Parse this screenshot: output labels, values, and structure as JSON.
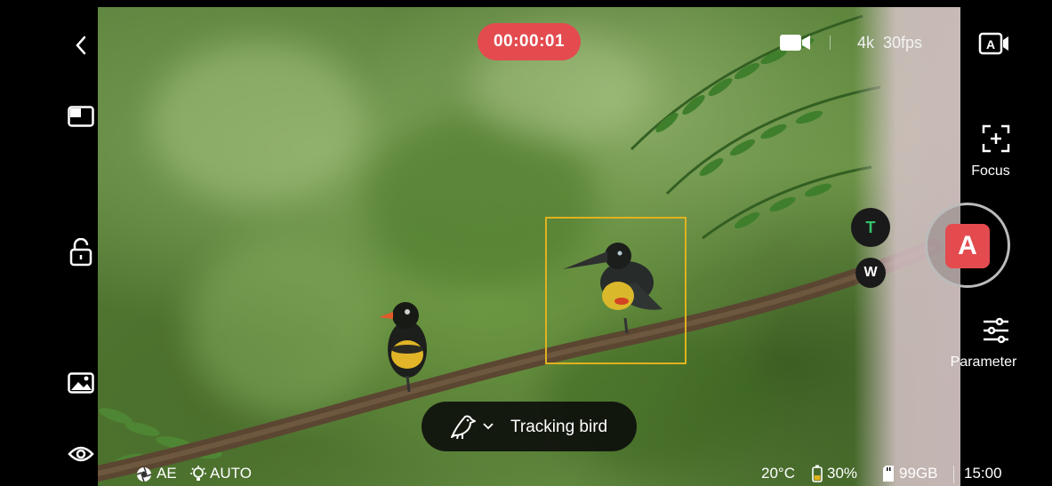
{
  "recording": {
    "timer": "00:00:01"
  },
  "top_bar": {
    "resolution": "4k  30fps"
  },
  "right_panel": {
    "focus_label": "Focus",
    "parameter_label": "Parameter",
    "zoom_tele": "T",
    "zoom_wide": "W",
    "shutter_mode": "A"
  },
  "tracking": {
    "label": "Tracking bird"
  },
  "status_left": {
    "ae_label": "AE",
    "wb_label": "AUTO"
  },
  "status_right": {
    "temperature": "20°C",
    "battery": "30%",
    "storage": "99GB",
    "remaining_time": "15:00"
  },
  "icons": {
    "back": "chevron-left-icon",
    "layout": "layout-icon",
    "lock": "unlock-icon",
    "gallery": "gallery-icon",
    "eye": "eye-icon",
    "camera": "video-camera-icon",
    "auto_video": "auto-video-icon",
    "focus": "focus-add-icon",
    "parameter": "sliders-icon",
    "bird": "bird-icon",
    "chevron_down": "chevron-down-icon",
    "aperture": "aperture-icon",
    "bulb": "bulb-icon",
    "battery": "battery-icon",
    "sd_card": "sd-card-icon"
  },
  "colors": {
    "record_red": "#e34b4f",
    "focus_yellow": "#e0b21e",
    "zoom_green": "#34c26a"
  }
}
